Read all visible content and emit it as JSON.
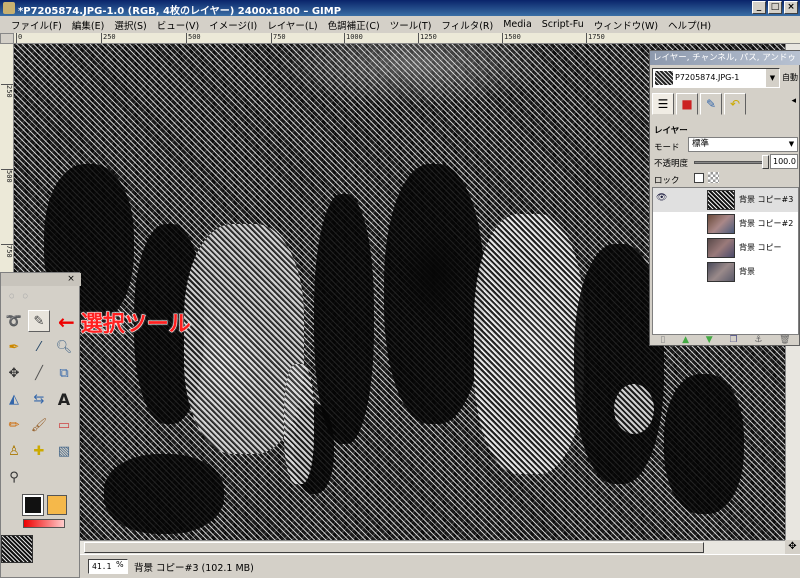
{
  "window": {
    "title": "*P7205874.JPG-1.0 (RGB, 4枚のレイヤー) 2400x1800 – GIMP",
    "minimize": "_",
    "maximize": "□",
    "close": "×"
  },
  "menu": [
    "ファイル(F)",
    "編集(E)",
    "選択(S)",
    "ビュー(V)",
    "イメージ(I)",
    "レイヤー(L)",
    "色調補正(C)",
    "ツール(T)",
    "フィルタ(R)",
    "Media",
    "Script-Fu",
    "ウィンドウ(W)",
    "ヘルプ(H)"
  ],
  "ruler": {
    "h_labels": [
      "0",
      "250",
      "500",
      "750",
      "1000",
      "1250",
      "1500",
      "1750"
    ],
    "v_labels": [
      "250",
      "500",
      "750"
    ]
  },
  "status": {
    "zoom": "41.1",
    "zoom_unit": "%",
    "text": "背景 コピー#3 (102.1 MB)"
  },
  "annotation": {
    "arrow": "←",
    "label": "選択ツール"
  },
  "toolbox": {
    "close": "×",
    "tools": [
      "lasso-icon",
      "fuzzy-select-icon",
      "move-icon",
      "color-picker-icon",
      "paths-icon",
      "magnify-icon",
      "measure-icon",
      "transform-icon",
      "flip-icon",
      "text-icon",
      "pencil-icon",
      "paintbrush-icon",
      "eraser-icon",
      "clone-icon",
      "heal-icon",
      "bucket-fill-icon",
      "smudge-icon"
    ],
    "colors": {
      "foreground": "#111111",
      "background": "#f5b84a"
    }
  },
  "dock": {
    "title": "レイヤー, チャンネル, パス, アンドゥ",
    "image": "P7205874.JPG-1",
    "auto_button": "自動",
    "tab_menu": "◂",
    "layers_heading": "レイヤー",
    "mode_label": "モード",
    "mode_value": "標準",
    "opacity_label": "不透明度",
    "opacity_value": "100.0",
    "opacity": 1.0,
    "lock_label": "ロック",
    "layers": [
      {
        "name": "背景 コピー#3",
        "visible": true,
        "selected": true
      },
      {
        "name": "背景 コピー#2",
        "visible": false,
        "selected": false
      },
      {
        "name": "背景 コピー",
        "visible": false,
        "selected": false
      },
      {
        "name": "背景",
        "visible": false,
        "selected": false
      }
    ],
    "layer_buttons": [
      "new-layer-icon",
      "raise-layer-icon",
      "lower-layer-icon",
      "duplicate-layer-icon",
      "anchor-layer-icon",
      "delete-layer-icon"
    ]
  }
}
